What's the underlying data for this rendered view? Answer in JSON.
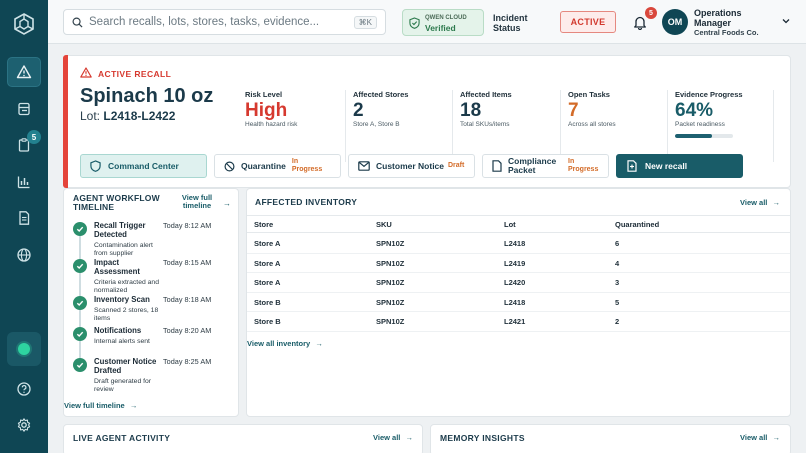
{
  "search": {
    "placeholder": "Search recalls, lots, stores, tasks, evidence...",
    "shortcut": "⌘K"
  },
  "cloud": {
    "label": "QWEN CLOUD",
    "status": "Verified"
  },
  "incident": {
    "label": "Incident Status",
    "status": "ACTIVE"
  },
  "notifications": {
    "count": "5"
  },
  "user": {
    "initials": "OM",
    "name": "Operations Manager",
    "org": "Central Foods Co."
  },
  "sidebar": {
    "tasks_badge": "5"
  },
  "recall": {
    "label": "ACTIVE RECALL",
    "product": "Spinach 10 oz",
    "lot_prefix": "Lot:",
    "lot": "L2418-L2422",
    "metrics": {
      "risk": {
        "label": "Risk Level",
        "value": "High",
        "sub": "Health hazard risk"
      },
      "stores": {
        "label": "Affected Stores",
        "value": "2",
        "sub": "Store A, Store B"
      },
      "items": {
        "label": "Affected Items",
        "value": "18",
        "sub": "Total SKUs/items"
      },
      "tasks": {
        "label": "Open Tasks",
        "value": "7",
        "sub": "Across all stores"
      },
      "evidence": {
        "label": "Evidence Progress",
        "value": "64%",
        "sub": "Packet readiness",
        "progress": 0.64
      }
    },
    "actions": {
      "command": {
        "label": "Command Center"
      },
      "quarantine": {
        "label": "Quarantine",
        "status": "In Progress"
      },
      "notice": {
        "label": "Customer Notice",
        "status": "Draft"
      },
      "packet": {
        "label": "Compliance Packet",
        "status": "In Progress"
      },
      "new": {
        "label": "New recall"
      }
    }
  },
  "workflow": {
    "title": "AGENT WORKFLOW TIMELINE",
    "view_top": "View full timeline",
    "view_bottom": "View full timeline",
    "steps": [
      {
        "name": "Recall Trigger Detected",
        "desc": "Contamination alert from supplier",
        "time": "Today 8:12 AM"
      },
      {
        "name": "Impact Assessment",
        "desc": "Criteria extracted and normalized",
        "time": "Today 8:15 AM"
      },
      {
        "name": "Inventory Scan",
        "desc": "Scanned 2 stores, 18 items",
        "time": "Today 8:18 AM"
      },
      {
        "name": "Notifications",
        "desc": "Internal alerts sent",
        "time": "Today 8:20 AM"
      },
      {
        "name": "Customer Notice Drafted",
        "desc": "Draft generated for review",
        "time": "Today 8:25 AM"
      }
    ]
  },
  "inventory": {
    "title": "AFFECTED INVENTORY",
    "view_all": "View all",
    "view_link": "View all inventory",
    "headers": {
      "store": "Store",
      "sku": "SKU",
      "lot": "Lot",
      "qty": "Quarantined"
    },
    "rows": [
      {
        "store": "Store A",
        "sku": "SPN10Z",
        "lot": "L2418",
        "qty": "6"
      },
      {
        "store": "Store A",
        "sku": "SPN10Z",
        "lot": "L2419",
        "qty": "4"
      },
      {
        "store": "Store A",
        "sku": "SPN10Z",
        "lot": "L2420",
        "qty": "3"
      },
      {
        "store": "Store B",
        "sku": "SPN10Z",
        "lot": "L2418",
        "qty": "5"
      },
      {
        "store": "Store B",
        "sku": "SPN10Z",
        "lot": "L2421",
        "qty": "2"
      }
    ]
  },
  "live": {
    "title": "LIVE AGENT ACTIVITY",
    "view_all": "View all"
  },
  "memory": {
    "title": "MEMORY INSIGHTS",
    "view_all": "View all"
  },
  "colors": {
    "brand": "#0f4654",
    "alert": "#e4443a",
    "accent": "#195c68",
    "warning": "#d36b28",
    "success": "#2b8f6c"
  }
}
